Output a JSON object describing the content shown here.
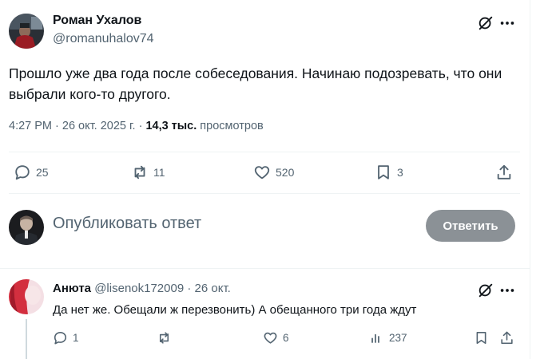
{
  "tweet": {
    "author_name": "Роман Ухалов",
    "author_handle": "@romanuhalov74",
    "text": "Прошло уже два года после собеседования. Начинаю подозревать, что они выбрали кого-то другого.",
    "time": "4:27 PM",
    "date": "26 окт. 2025 г.",
    "views_count": "14,3 тыс.",
    "views_label": "просмотров",
    "actions": {
      "replies": "25",
      "reposts": "11",
      "likes": "520",
      "bookmarks": "3"
    }
  },
  "composer": {
    "placeholder": "Опубликовать ответ",
    "button_label": "Ответить"
  },
  "reply": {
    "author_name": "Анюта",
    "author_handle": "@lisenok172009",
    "date": "26 окт.",
    "text": "Да нет же. Обещали ж перезвонить) А обещанного три года ждут",
    "actions": {
      "replies": "1",
      "reposts": "",
      "likes": "6",
      "views": "237"
    }
  },
  "icons": {
    "reply": "reply-icon",
    "repost": "repost-icon",
    "like": "heart-icon",
    "bookmark": "bookmark-icon",
    "share": "share-icon",
    "views": "views-icon",
    "grok": "grok-icon",
    "more": "more-icon"
  },
  "colors": {
    "text": "#0f1419",
    "secondary": "#536471",
    "reply_button_bg": "#8b9196",
    "divider": "#eff3f4"
  }
}
